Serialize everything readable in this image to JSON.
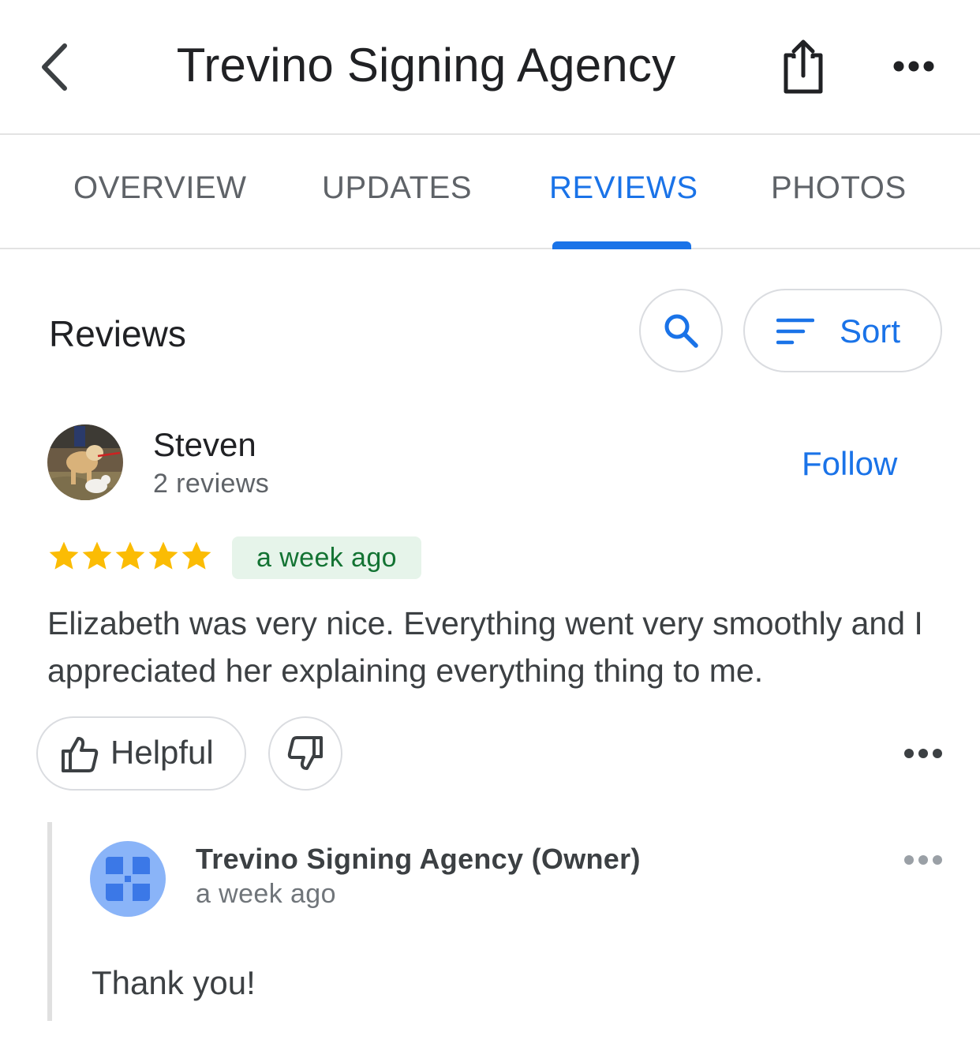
{
  "header": {
    "title": "Trevino Signing Agency",
    "back_icon": "chevron-left-icon",
    "share_icon": "share-icon",
    "more_icon": "more-horizontal-icon"
  },
  "tabs": [
    {
      "label": "OVERVIEW",
      "active": false
    },
    {
      "label": "UPDATES",
      "active": false
    },
    {
      "label": "REVIEWS",
      "active": true
    },
    {
      "label": "PHOTOS",
      "active": false
    }
  ],
  "reviews_section": {
    "heading": "Reviews",
    "search_icon": "search-icon",
    "sort_label": "Sort",
    "sort_icon": "sort-lines-icon"
  },
  "review": {
    "reviewer_name": "Steven",
    "reviewer_count": "2 reviews",
    "follow_label": "Follow",
    "rating": 5,
    "rating_max": 5,
    "date": "a week ago",
    "text": "Elizabeth was very nice. Everything went very smoothly and I appreciated her explaining everything thing to me.",
    "helpful_label": "Helpful",
    "helpful_icon": "thumbs-up-icon",
    "unhelpful_icon": "thumbs-down-icon"
  },
  "owner_response": {
    "name": "Trevino Signing Agency (Owner)",
    "time": "a week ago",
    "text": "Thank you!"
  },
  "colors": {
    "accent": "#1a73e8",
    "star": "#fbbc04",
    "date_badge_bg": "#e6f4ea",
    "date_badge_text": "#137333",
    "owner_avatar_bg": "#8ab4f8"
  }
}
